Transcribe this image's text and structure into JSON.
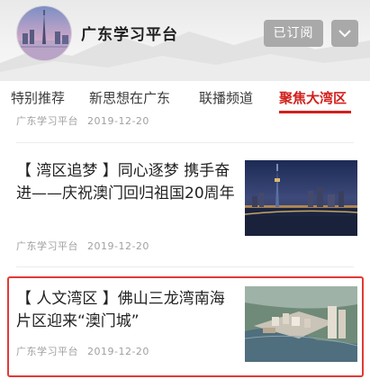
{
  "header": {
    "channel_name": "广东学习平台",
    "subscribe_label": "已订阅"
  },
  "tabs": [
    {
      "label": "特别推荐"
    },
    {
      "label": "新思想在广东"
    },
    {
      "label": "联播频道"
    },
    {
      "label": "聚焦大湾区",
      "active": true
    }
  ],
  "articles": [
    {
      "source": "广东学习平台",
      "date": "2019-12-20"
    },
    {
      "title": "【 湾区追梦 】同心逐梦 携手奋进——庆祝澳门回归祖国20周年",
      "source": "广东学习平台",
      "date": "2019-12-20"
    },
    {
      "title": "【 人文湾区 】佛山三龙湾南海片区迎来“澳门城”",
      "source": "广东学习平台",
      "date": "2019-12-20"
    }
  ],
  "colors": {
    "accent": "#d1201c",
    "highlight_border": "#e23a36",
    "button_gray": "#a9a9a9"
  }
}
